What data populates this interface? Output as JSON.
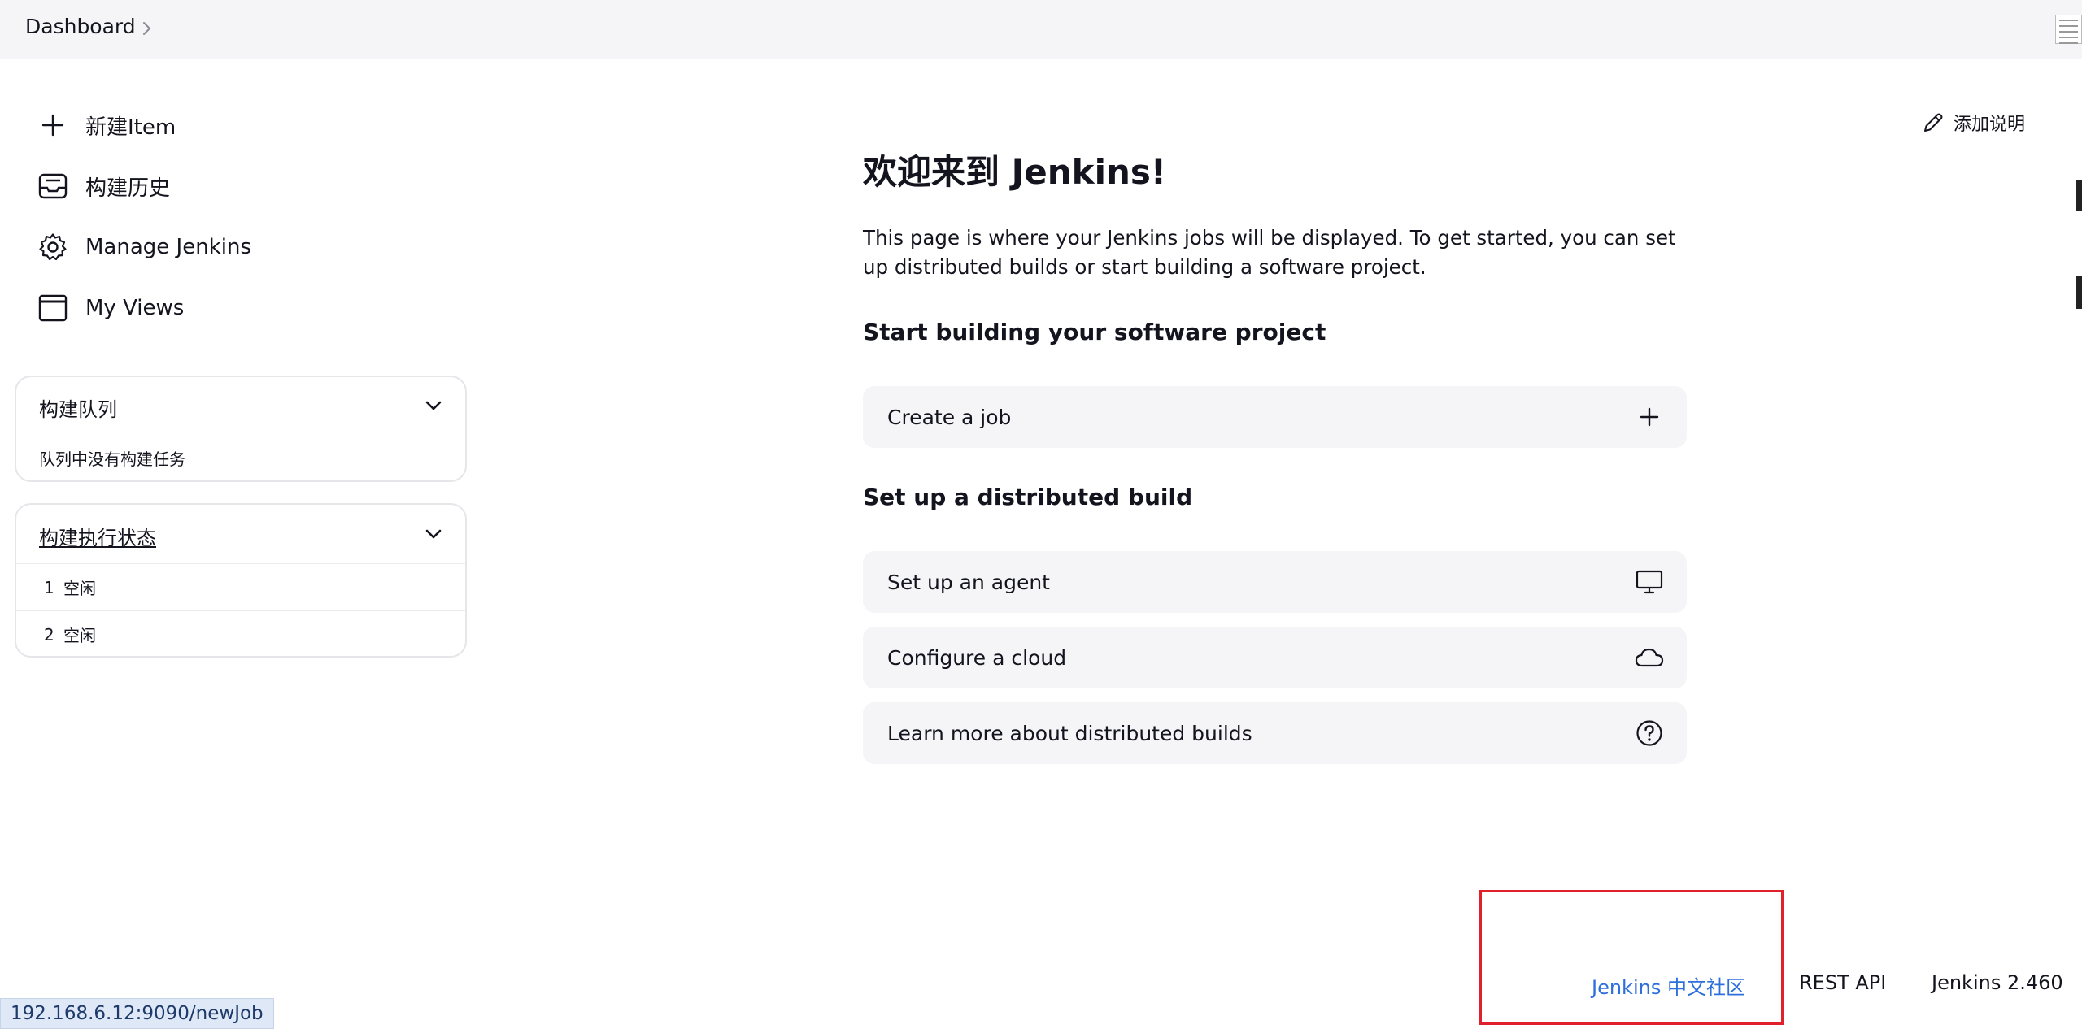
{
  "breadcrumb": {
    "items": [
      "Dashboard"
    ]
  },
  "sidebar": {
    "tasks": [
      {
        "label": "新建Item",
        "icon": "plus-icon"
      },
      {
        "label": "构建历史",
        "icon": "inbox-icon"
      },
      {
        "label": "Manage Jenkins",
        "icon": "gear-icon"
      },
      {
        "label": "My Views",
        "icon": "window-icon"
      }
    ],
    "build_queue": {
      "title": "构建队列",
      "empty_text": "队列中没有构建任务"
    },
    "executors": {
      "title": "构建执行状态",
      "rows": [
        {
          "number": "1",
          "status": "空闲"
        },
        {
          "number": "2",
          "status": "空闲"
        }
      ]
    }
  },
  "main": {
    "add_description": "添加说明",
    "welcome_title": "欢迎来到 Jenkins!",
    "intro": "This page is where your Jenkins jobs will be displayed. To get started, you can set up distributed builds or start building a software project.",
    "section_start": "Start building your software project",
    "create_job": "Create a job",
    "section_distributed": "Set up a distributed build",
    "distributed_actions": [
      {
        "label": "Set up an agent",
        "icon": "monitor-icon"
      },
      {
        "label": "Configure a cloud",
        "icon": "cloud-icon"
      },
      {
        "label": "Learn more about distributed builds",
        "icon": "help-circle-icon"
      }
    ]
  },
  "footer": {
    "community_link": "Jenkins 中文社区",
    "rest_api": "REST API",
    "version": "Jenkins 2.460"
  },
  "status_bar": {
    "url": "192.168.6.12:9090/newJob"
  },
  "colors": {
    "link": "#2f6fdb",
    "highlight_border": "#e0202a",
    "card_bg": "#f5f5f7"
  }
}
